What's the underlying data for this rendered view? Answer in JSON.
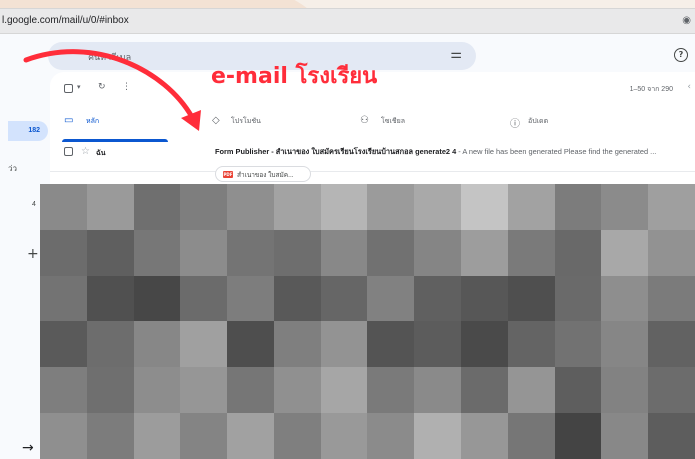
{
  "browser": {
    "url": "l.google.com/mail/u/0/#inbox"
  },
  "search": {
    "placeholder": "ค้นหาอีเมล"
  },
  "left_rail": {
    "inbox_count": "182",
    "label_fragment": "ว่ว",
    "count_small": "4"
  },
  "toolbar": {
    "pagination": "1–50 จาก 290"
  },
  "tabs": [
    {
      "label": "หลัก",
      "icon": "inbox-icon",
      "active": true
    },
    {
      "label": "โปรโมชัน",
      "icon": "tag-icon",
      "active": false
    },
    {
      "label": "โซเชียล",
      "icon": "people-icon",
      "active": false
    },
    {
      "label": "อัปเดต",
      "icon": "info-icon",
      "active": false
    }
  ],
  "email": {
    "sender": "ฉัน",
    "subject": "Form Publisher - สำเนาของ ใบสมัครเรียนโรงเรียนบ้านสกอล generate2 4",
    "snippet": " - A new file has been generated Please find the generated ...",
    "attachment": {
      "label": "สำเนาของ ใบสมัค...",
      "icon": "pdf-icon",
      "icon_text": "PDF"
    }
  },
  "annotation": {
    "text": "e-mail โรงเรียน",
    "color": "#ff2d3a"
  },
  "colors": {
    "accent": "#0b57d0",
    "annotation": "#ff2d3a"
  }
}
